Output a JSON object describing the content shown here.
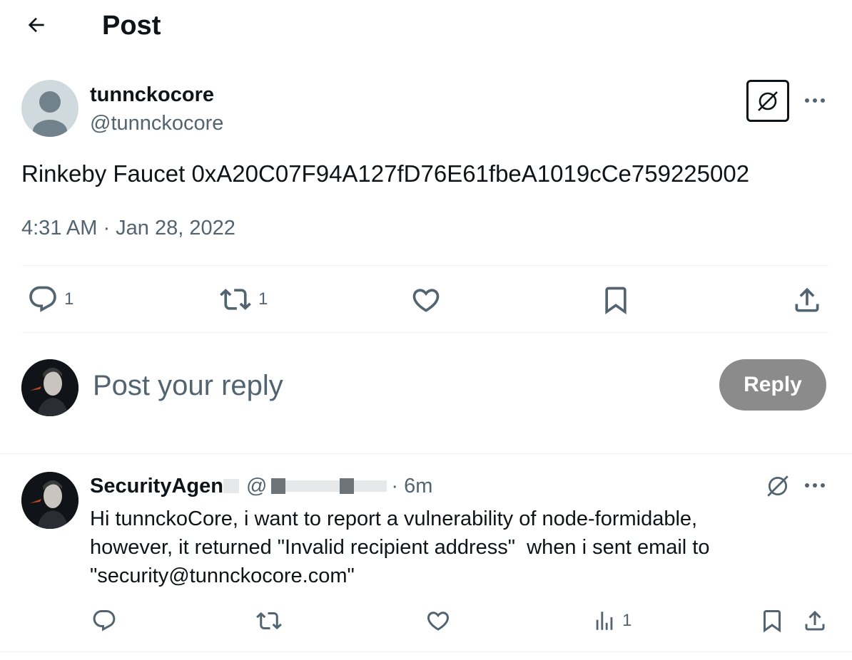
{
  "header": {
    "title": "Post"
  },
  "post": {
    "author_name": "tunnckocore",
    "author_handle": "@tunnckocore",
    "text": "Rinkeby Faucet 0xA20C07F94A127fD76E61fbeA1019cCe759225002",
    "timestamp": "4:31 AM · Jan 28, 2022",
    "actions": {
      "reply_count": "1",
      "repost_count": "1"
    }
  },
  "composer": {
    "placeholder": "Post your reply",
    "reply_label": "Reply"
  },
  "reply": {
    "author_name": "SecurityAgen",
    "handle_fragment": "@",
    "time_ago": "· 6m",
    "text_line1": "Hi tunnckoCore, i want to report a vulnerability of node-formidable,",
    "text_line2": "however, it returned \"Invalid recipient address\"  when i sent email to",
    "text_line3": "\"security@tunnckocore.com\"",
    "actions": {
      "views_count": "1"
    }
  },
  "colors": {
    "text": "#0f1419",
    "secondary": "#536471",
    "divider": "#eff3f4",
    "reply_button_disabled": "#8b8b8b"
  }
}
